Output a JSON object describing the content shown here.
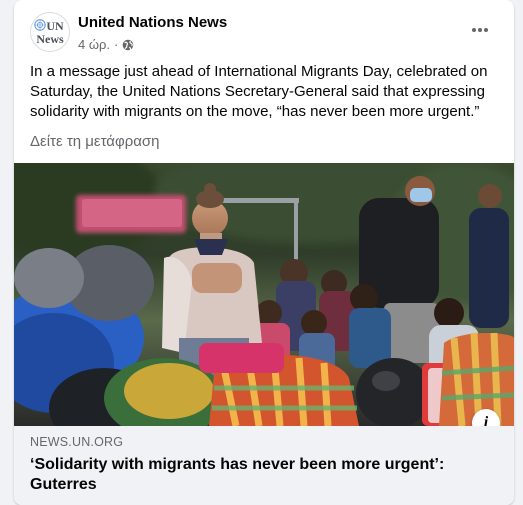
{
  "post": {
    "page_name": "United Nations News",
    "time": "4 ώρ.",
    "separator": "·",
    "privacy_icon": "globe-icon",
    "more_icon": "more-options-icon",
    "avatar": {
      "line1": "UN",
      "line2": "News",
      "emblem_icon": "un-emblem-icon"
    },
    "text": "In a message just ahead of International Migrants Day, celebrated on Saturday, the United Nations Secretary-General said that expressing solidarity with migrants on the move, “has never been more urgent.”",
    "translate_label": "Δείτε τη μετάφραση"
  },
  "link_preview": {
    "domain": "NEWS.UN.ORG",
    "title": "‘Solidarity with migrants has never been more urgent’: Guterres",
    "info_icon": "info-icon",
    "info_glyph": "i",
    "photo_description": "migrants-photo"
  },
  "colors": {
    "card_bg": "#ffffff",
    "page_bg": "#f0f2f5",
    "secondary_text": "#65676b",
    "primary_text": "#050505",
    "link_box_bg": "#f0f2f5"
  }
}
